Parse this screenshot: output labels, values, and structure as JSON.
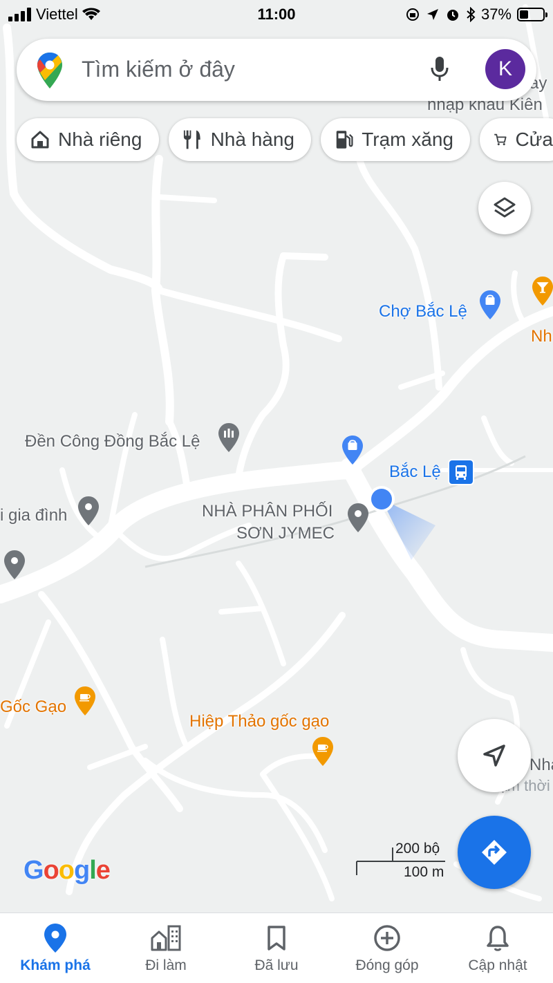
{
  "status_bar": {
    "carrier": "Viettel",
    "time": "11:00",
    "battery": "37%",
    "battery_level": 0.37
  },
  "search": {
    "placeholder": "Tìm kiếm ở đây",
    "avatar_letter": "K"
  },
  "chips": [
    {
      "label": "Nhà riêng",
      "icon": "home-icon"
    },
    {
      "label": "Nhà hàng",
      "icon": "restaurant-icon"
    },
    {
      "label": "Trạm xăng",
      "icon": "gas-station-icon"
    },
    {
      "label": "Cửa",
      "icon": "shopping-cart-icon"
    }
  ],
  "map_labels": {
    "top_right_1": "ay",
    "top_right_2": "nhập khẩu Kiên",
    "cho_bac_le": "Chợ Bắc Lệ",
    "nh_right": "Nh",
    "den_cong_dong": "Đền Công Đồng Bắc Lệ",
    "bac_le": "Bắc Lệ",
    "gia_dinh": "i gia đình",
    "nha_phan_phoi_1": "NHÀ PHÂN PHỐI",
    "nha_phan_phoi_2": "SƠN JYMEC",
    "goc_gao": "Gốc Gạo",
    "hiep_thao": "Hiệp Thảo gốc gạo",
    "nha_right": "Nha",
    "tam_thoi": "Tạm thời đ"
  },
  "scale": {
    "imperial": "200 bộ",
    "metric": "100 m"
  },
  "google_logo": "Google",
  "bottom_nav": [
    {
      "label": "Khám phá",
      "icon": "explore-pin-icon",
      "active": true
    },
    {
      "label": "Đi làm",
      "icon": "commute-icon",
      "active": false
    },
    {
      "label": "Đã lưu",
      "icon": "bookmark-icon",
      "active": false
    },
    {
      "label": "Đóng góp",
      "icon": "add-circle-icon",
      "active": false
    },
    {
      "label": "Cập nhật",
      "icon": "bell-icon",
      "active": false
    }
  ],
  "colors": {
    "map_bg": "#eef0f0",
    "road": "#ffffff",
    "accent_blue": "#1a73e8",
    "poi_gray": "#70757a",
    "poi_orange": "#f29900",
    "avatar": "#5b2a9e"
  }
}
